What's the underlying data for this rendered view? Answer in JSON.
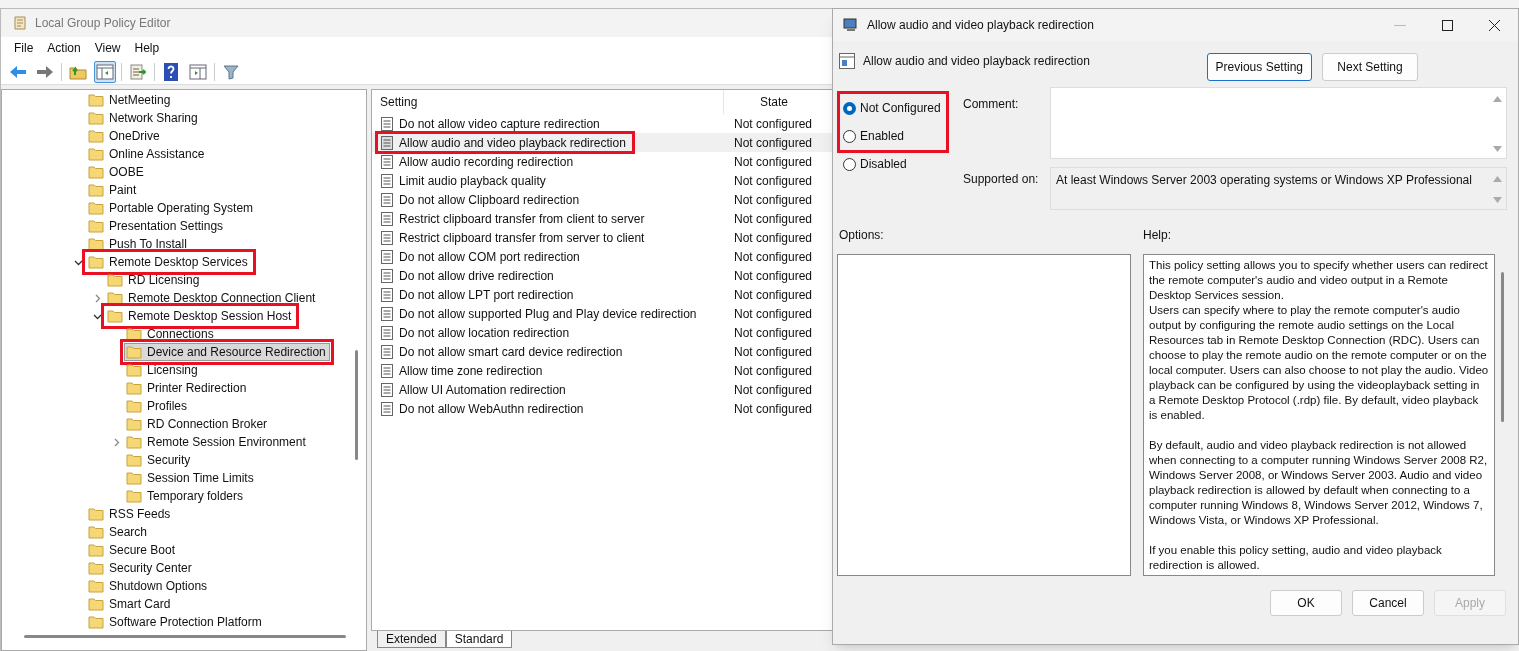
{
  "editor": {
    "title": "Local Group Policy Editor",
    "menu": [
      "File",
      "Action",
      "View",
      "Help"
    ],
    "toolbar": [
      {
        "kind": "back",
        "selected": false
      },
      {
        "kind": "forward",
        "selected": false
      },
      {
        "kind": "up",
        "selected": false
      },
      {
        "kind": "tree",
        "selected": true
      },
      {
        "kind": "export",
        "selected": false
      },
      {
        "kind": "help",
        "selected": false
      },
      {
        "kind": "pane",
        "selected": false
      },
      {
        "kind": "filter",
        "selected": false
      }
    ],
    "tree": [
      {
        "label": "NetMeeting",
        "selected": false,
        "highlighted": false
      },
      {
        "label": "Network Sharing",
        "selected": false,
        "highlighted": false
      },
      {
        "label": "OneDrive",
        "selected": false,
        "highlighted": false
      },
      {
        "label": "Online Assistance",
        "selected": false,
        "highlighted": false
      },
      {
        "label": "OOBE",
        "selected": false,
        "highlighted": false
      },
      {
        "label": "Paint",
        "selected": false,
        "highlighted": false
      },
      {
        "label": "Portable Operating System",
        "selected": false,
        "highlighted": false
      },
      {
        "label": "Presentation Settings",
        "selected": false,
        "highlighted": false
      },
      {
        "label": "Push To Install",
        "selected": false,
        "highlighted": false
      },
      {
        "label": "Remote Desktop Services",
        "selected": false,
        "highlighted": true,
        "expanded": true,
        "children": [
          {
            "label": "RD Licensing",
            "selected": false,
            "highlighted": false
          },
          {
            "label": "Remote Desktop Connection Client",
            "selected": false,
            "highlighted": false,
            "expanded": false
          },
          {
            "label": "Remote Desktop Session Host",
            "selected": false,
            "highlighted": true,
            "expanded": true,
            "children": [
              {
                "label": "Connections",
                "selected": false,
                "highlighted": false
              },
              {
                "label": "Device and Resource Redirection",
                "selected": true,
                "highlighted": true
              },
              {
                "label": "Licensing",
                "selected": false,
                "highlighted": false
              },
              {
                "label": "Printer Redirection",
                "selected": false,
                "highlighted": false
              },
              {
                "label": "Profiles",
                "selected": false,
                "highlighted": false
              },
              {
                "label": "RD Connection Broker",
                "selected": false,
                "highlighted": false
              },
              {
                "label": "Remote Session Environment",
                "selected": false,
                "highlighted": false,
                "expanded": false
              },
              {
                "label": "Security",
                "selected": false,
                "highlighted": false
              },
              {
                "label": "Session Time Limits",
                "selected": false,
                "highlighted": false
              },
              {
                "label": "Temporary folders",
                "selected": false,
                "highlighted": false
              }
            ]
          }
        ]
      },
      {
        "label": "RSS Feeds",
        "selected": false,
        "highlighted": false
      },
      {
        "label": "Search",
        "selected": false,
        "highlighted": false
      },
      {
        "label": "Secure Boot",
        "selected": false,
        "highlighted": false
      },
      {
        "label": "Security Center",
        "selected": false,
        "highlighted": false
      },
      {
        "label": "Shutdown Options",
        "selected": false,
        "highlighted": false
      },
      {
        "label": "Smart Card",
        "selected": false,
        "highlighted": false
      },
      {
        "label": "Software Protection Platform",
        "selected": false,
        "highlighted": false
      }
    ],
    "table": {
      "columns": [
        "Setting",
        "State"
      ],
      "rows": [
        {
          "setting": "Do not allow video capture redirection",
          "state": "Not configured",
          "selected": false,
          "highlighted": false
        },
        {
          "setting": "Allow audio and video playback redirection",
          "state": "Not configured",
          "selected": true,
          "highlighted": true
        },
        {
          "setting": "Allow audio recording redirection",
          "state": "Not configured",
          "selected": false,
          "highlighted": false
        },
        {
          "setting": "Limit audio playback quality",
          "state": "Not configured",
          "selected": false,
          "highlighted": false
        },
        {
          "setting": "Do not allow Clipboard redirection",
          "state": "Not configured",
          "selected": false,
          "highlighted": false
        },
        {
          "setting": "Restrict clipboard transfer from client to server",
          "state": "Not configured",
          "selected": false,
          "highlighted": false
        },
        {
          "setting": "Restrict clipboard transfer from server to client",
          "state": "Not configured",
          "selected": false,
          "highlighted": false
        },
        {
          "setting": "Do not allow COM port redirection",
          "state": "Not configured",
          "selected": false,
          "highlighted": false
        },
        {
          "setting": "Do not allow drive redirection",
          "state": "Not configured",
          "selected": false,
          "highlighted": false
        },
        {
          "setting": "Do not allow LPT port redirection",
          "state": "Not configured",
          "selected": false,
          "highlighted": false
        },
        {
          "setting": "Do not allow supported Plug and Play device redirection",
          "state": "Not configured",
          "selected": false,
          "highlighted": false
        },
        {
          "setting": "Do not allow location redirection",
          "state": "Not configured",
          "selected": false,
          "highlighted": false
        },
        {
          "setting": "Do not allow smart card device redirection",
          "state": "Not configured",
          "selected": false,
          "highlighted": false
        },
        {
          "setting": "Allow time zone redirection",
          "state": "Not configured",
          "selected": false,
          "highlighted": false
        },
        {
          "setting": "Allow UI Automation redirection",
          "state": "Not configured",
          "selected": false,
          "highlighted": false
        },
        {
          "setting": "Do not allow WebAuthn redirection",
          "state": "Not configured",
          "selected": false,
          "highlighted": false
        }
      ]
    },
    "tabs": [
      {
        "label": "Extended",
        "selected": false
      },
      {
        "label": "Standard",
        "selected": true
      }
    ]
  },
  "dialog": {
    "title": "Allow audio and video playback redirection",
    "heading": "Allow audio and video playback redirection",
    "nav_buttons": [
      "Previous Setting",
      "Next Setting"
    ],
    "options_highlighted": true,
    "radios": [
      {
        "label": "Not Configured",
        "selected": true
      },
      {
        "label": "Enabled",
        "selected": false
      },
      {
        "label": "Disabled",
        "selected": false
      }
    ],
    "comment_label": "Comment:",
    "supported_label": "Supported on:",
    "supported_value": "At least Windows Server 2003 operating systems or Windows XP Professional",
    "options_label": "Options:",
    "help_label": "Help:",
    "help": [
      [
        "This policy setting allows you to specify whether users can redirect the remote computer's audio and video output in a Remote Desktop Services session.",
        "Users can specify where to play the remote computer's audio output by configuring the remote audio settings on the Local Resources tab in Remote Desktop Connection (RDC). Users can choose to play the remote audio on the remote computer or on the local computer. Users can also choose to not play the audio. Video playback can be configured by using the videoplayback setting in a Remote Desktop Protocol (.rdp) file. By default, video playback is enabled."
      ],
      [
        "By default, audio and video playback redirection is not allowed when connecting to a computer running Windows Server 2008 R2, Windows Server 2008, or Windows Server 2003. Audio and video playback redirection is allowed by default when connecting to a computer running Windows 8, Windows Server 2012, Windows 7, Windows Vista, or Windows XP Professional."
      ],
      [
        "If you enable this policy setting, audio and video playback redirection is allowed."
      ]
    ],
    "buttons": [
      {
        "label": "OK",
        "disabled": false
      },
      {
        "label": "Cancel",
        "disabled": false
      },
      {
        "label": "Apply",
        "disabled": true
      }
    ]
  }
}
